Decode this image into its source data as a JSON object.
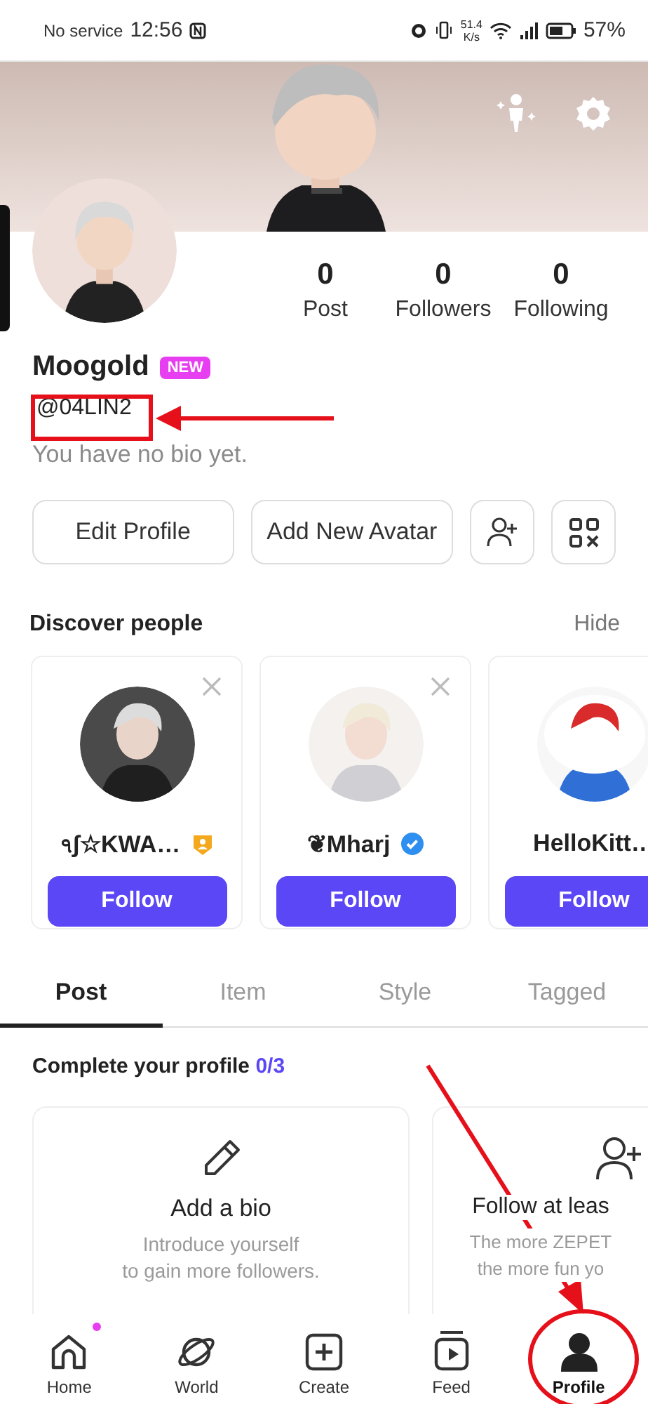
{
  "status_bar": {
    "carrier": "No service",
    "time": "12:56",
    "speed": "51.4",
    "speed_unit": "K/s",
    "battery": "57%"
  },
  "profile": {
    "name": "Moogold",
    "badge": "NEW",
    "handle": "@04LIN2",
    "bio": "You have no bio yet.",
    "stats": [
      {
        "value": "0",
        "label": "Post"
      },
      {
        "value": "0",
        "label": "Followers"
      },
      {
        "value": "0",
        "label": "Following"
      }
    ],
    "buttons": [
      "Edit Profile",
      "Add New Avatar"
    ]
  },
  "discover": {
    "title": "Discover people",
    "hide": "Hide",
    "people": [
      {
        "name": "ঀʃ☆KWA…",
        "kind": "creator",
        "action": "Follow",
        "closable": true
      },
      {
        "name": "❦Mharj",
        "kind": "verified",
        "action": "Follow",
        "closable": true
      },
      {
        "name": "HelloKitt…",
        "kind": "plain",
        "action": "Follow"
      }
    ]
  },
  "tabs": [
    {
      "label": "Post",
      "selected": true
    },
    {
      "label": "Item",
      "selected": false
    },
    {
      "label": "Style",
      "selected": false
    },
    {
      "label": "Tagged",
      "selected": false
    }
  ],
  "complete": {
    "title": "Complete your profile",
    "progress": "0/3",
    "tasks": [
      {
        "kind": "bio",
        "title": "Add a bio",
        "lines": [
          "Introduce yourself",
          "to gain more followers."
        ]
      },
      {
        "kind": "follow",
        "title": "Follow at leas",
        "lines": [
          "The more ZEPET",
          "the more fun yo"
        ]
      }
    ]
  },
  "nav": [
    {
      "kind": "home",
      "label": "Home",
      "selected": false,
      "notification": true
    },
    {
      "kind": "world",
      "label": "World",
      "selected": false,
      "notification": false
    },
    {
      "kind": "create",
      "label": "Create",
      "selected": false,
      "notification": false
    },
    {
      "kind": "feed",
      "label": "Feed",
      "selected": false,
      "notification": false
    },
    {
      "kind": "profile",
      "label": "Profile",
      "selected": true,
      "notification": false
    }
  ]
}
